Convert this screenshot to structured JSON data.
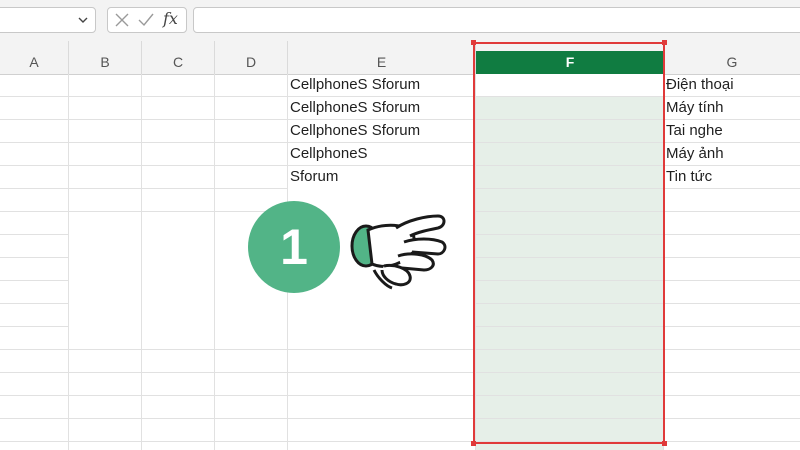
{
  "formula_bar": {
    "name_box_value": "",
    "fx_label": "fx",
    "formula_value": ""
  },
  "columns": [
    {
      "key": "A",
      "label": "A"
    },
    {
      "key": "B",
      "label": "B"
    },
    {
      "key": "C",
      "label": "C"
    },
    {
      "key": "D",
      "label": "D"
    },
    {
      "key": "E",
      "label": "E"
    },
    {
      "key": "F",
      "label": "F",
      "selected": true
    },
    {
      "key": "G",
      "label": "G"
    }
  ],
  "cells": {
    "E": [
      "CellphoneS Sforum",
      "CellphoneS Sforum",
      "CellphoneS Sforum",
      "CellphoneS",
      "Sforum"
    ],
    "G": [
      "Điện thoại",
      "Máy tính",
      "Tai nghe",
      "Máy ảnh",
      "Tin tức"
    ]
  },
  "annotation": {
    "step_number": "1",
    "badge_color": "#52b487",
    "highlight_color": "#e03a3a",
    "icon": "pointing-hand-icon"
  },
  "colors": {
    "selected_header": "#107c41",
    "selected_column_fill": "#e6efe8"
  }
}
